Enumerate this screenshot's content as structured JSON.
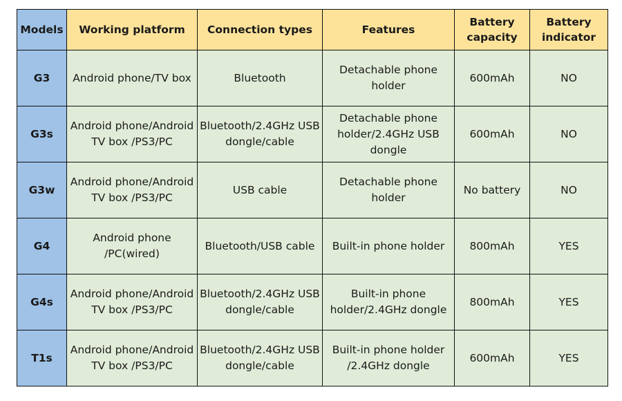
{
  "table": {
    "headers": [
      "Models",
      "Working platform",
      "Connection types",
      "Features",
      "Battery\ncapacity",
      "Battery\nindicator"
    ],
    "rows": [
      [
        "G3",
        "Android phone/TV box",
        "Bluetooth",
        "Detachable phone\nholder",
        "600mAh",
        "NO"
      ],
      [
        "G3s",
        "Android phone/Android\nTV box /PS3/PC",
        "Bluetooth/2.4GHz USB\ndongle/cable",
        "Detachable phone\nholder/2.4GHz USB\ndongle",
        "600mAh",
        "NO"
      ],
      [
        "G3w",
        "Android phone/Android\nTV box /PS3/PC",
        "USB cable",
        "Detachable phone\nholder",
        "No battery",
        "NO"
      ],
      [
        "G4",
        "Android phone\n/PC(wired)",
        "Bluetooth/USB cable",
        "Built-in phone holder",
        "800mAh",
        "YES"
      ],
      [
        "G4s",
        "Android phone/Android\nTV box /PS3/PC",
        "Bluetooth/2.4GHz USB\ndongle/cable",
        "Built-in phone\nholder/2.4GHz dongle",
        "800mAh",
        "YES"
      ],
      [
        "T1s",
        "Android phone/Android\nTV box /PS3/PC",
        "Bluetooth/2.4GHz USB\ndongle/cable",
        "Built-in phone holder\n/2.4GHz dongle",
        "600mAh",
        "YES"
      ]
    ]
  },
  "colors": {
    "header_bg": "#fde39a",
    "model_column_bg": "#9fc2e6",
    "body_bg": "#e1ecd8",
    "border": "#111111"
  }
}
